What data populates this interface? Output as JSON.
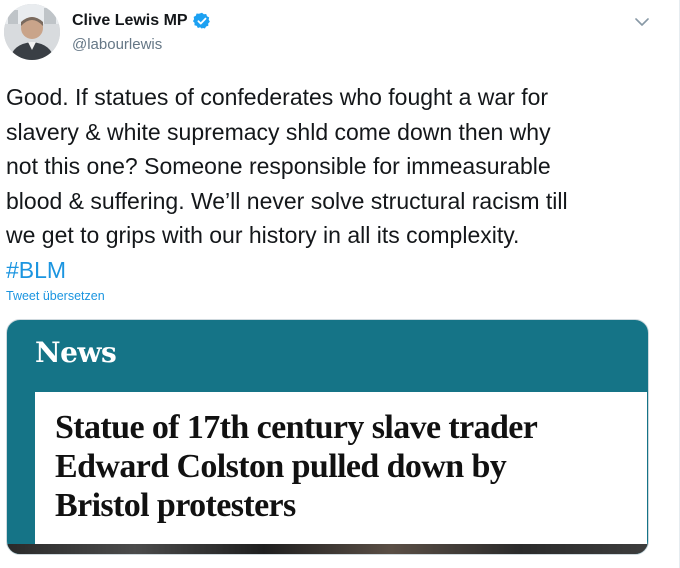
{
  "author": {
    "display_name": "Clive Lewis MP",
    "handle": "@labourlewis",
    "verified": true,
    "avatar_icon": "profile-photo"
  },
  "tweet": {
    "text": "Good. If statues of confederates who fought a war for\nslavery & white supremacy shld come down then why\nnot this one? Someone responsible for immeasurable\nblood & suffering. We’ll never solve structural racism till\nwe get to grips with our history in all its complexity.\n",
    "hashtag": "#BLM",
    "translate_label": "Tweet übersetzen"
  },
  "card": {
    "label": "News",
    "headline": "Statue of 17th century slave trader\nEdward Colston pulled down by\nBristol protesters"
  },
  "colors": {
    "link": "#1b95e0",
    "card_teal": "#157487",
    "verified": "#1da1f2"
  }
}
